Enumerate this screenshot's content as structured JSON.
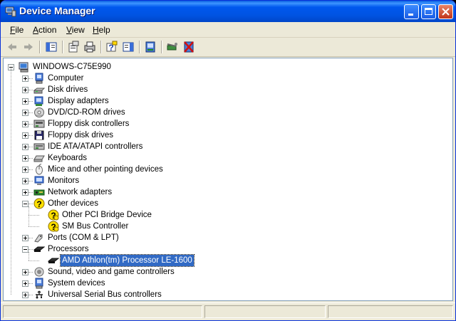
{
  "window": {
    "title": "Device Manager"
  },
  "menu": [
    {
      "label": "File",
      "accel": "F"
    },
    {
      "label": "Action",
      "accel": "A"
    },
    {
      "label": "View",
      "accel": "V"
    },
    {
      "label": "Help",
      "accel": "H"
    }
  ],
  "toolbar": [
    "back-icon",
    "forward-icon",
    "show-hide-tree-icon",
    "properties-icon",
    "print-icon",
    "help-icon",
    "show-hide-action-pane-icon",
    "update-driver-icon",
    "scan-hardware-icon",
    "uninstall-icon"
  ],
  "tree": {
    "root": "WINDOWS-C75E990",
    "categories": [
      {
        "label": "Computer",
        "icon": "computer-icon",
        "expanded": false
      },
      {
        "label": "Disk drives",
        "icon": "disk-drive-icon",
        "expanded": false
      },
      {
        "label": "Display adapters",
        "icon": "display-adapter-icon",
        "expanded": false
      },
      {
        "label": "DVD/CD-ROM drives",
        "icon": "cdrom-icon",
        "expanded": false
      },
      {
        "label": "Floppy disk controllers",
        "icon": "floppy-controller-icon",
        "expanded": false
      },
      {
        "label": "Floppy disk drives",
        "icon": "floppy-drive-icon",
        "expanded": false
      },
      {
        "label": "IDE ATA/ATAPI controllers",
        "icon": "ide-controller-icon",
        "expanded": false
      },
      {
        "label": "Keyboards",
        "icon": "keyboard-icon",
        "expanded": false
      },
      {
        "label": "Mice and other pointing devices",
        "icon": "mouse-icon",
        "expanded": false
      },
      {
        "label": "Monitors",
        "icon": "monitor-icon",
        "expanded": false
      },
      {
        "label": "Network adapters",
        "icon": "network-adapter-icon",
        "expanded": false
      },
      {
        "label": "Other devices",
        "icon": "unknown-device-icon",
        "expanded": true,
        "children": [
          "Other PCI Bridge Device",
          "SM Bus Controller"
        ]
      },
      {
        "label": "Ports (COM & LPT)",
        "icon": "port-icon",
        "expanded": false
      },
      {
        "label": "Processors",
        "icon": "processor-icon",
        "expanded": true,
        "children": [
          "AMD Athlon(tm) Processor LE-1600"
        ]
      },
      {
        "label": "Sound, video and game controllers",
        "icon": "sound-icon",
        "expanded": false
      },
      {
        "label": "System devices",
        "icon": "system-devices-icon",
        "expanded": false
      },
      {
        "label": "Universal Serial Bus controllers",
        "icon": "usb-icon",
        "expanded": false
      }
    ],
    "selected": "AMD Athlon(tm) Processor LE-1600"
  },
  "colors": {
    "titlebar": "#0054E3",
    "selection": "#316AC5",
    "warning": "#FFE000"
  }
}
